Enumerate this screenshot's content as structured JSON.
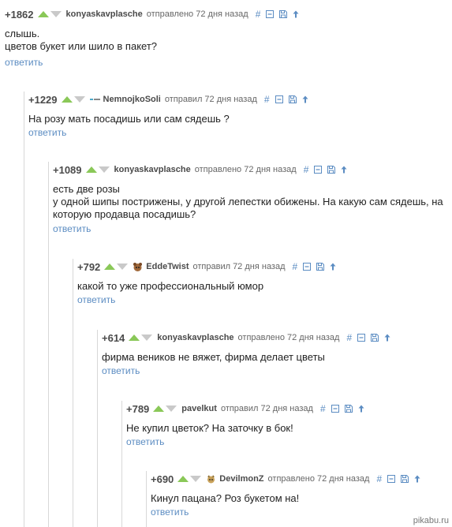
{
  "comments": [
    {
      "rating": "+1862",
      "user": "konyaskavplasche",
      "sent": "отправлено 72 дня назад",
      "avatar": "none",
      "lines": [
        "слышь.",
        "цветов букет или шило в пакет?"
      ],
      "reply": "ответить"
    },
    {
      "rating": "+1229",
      "user": "NemnojkoSoli",
      "sent": "отправил 72 дня назад",
      "avatar": "dash-avatar-icon",
      "lines": [
        "На розу мать посадишь или сам сядешь ?"
      ],
      "reply": "ответить"
    },
    {
      "rating": "+1089",
      "user": "konyaskavplasche",
      "sent": "отправлено 72 дня назад",
      "avatar": "none",
      "lines": [
        "есть две розы",
        "у одной шипы пострижены, у другой лепестки обижены. На какую сам сядешь, на",
        "которую продавца посадишь?"
      ],
      "reply": "ответить"
    },
    {
      "rating": "+792",
      "user": "EddeTwist",
      "sent": "отправил 72 дня назад",
      "avatar": "animal-avatar-icon",
      "lines": [
        "какой то уже профессиональный юмор"
      ],
      "reply": "ответить"
    },
    {
      "rating": "+614",
      "user": "konyaskavplasche",
      "sent": "отправлено 72 дня назад",
      "avatar": "none",
      "lines": [
        "фирма веников не вяжет, фирма делает цветы"
      ],
      "reply": "ответить"
    },
    {
      "rating": "+789",
      "user": "pavelkut",
      "sent": "отправил 72 дня назад",
      "avatar": "none",
      "lines": [
        "Не купил цветок? На заточку в бок!"
      ],
      "reply": "ответить"
    },
    {
      "rating": "+690",
      "user": "DevilmonZ",
      "sent": "отправлено 72 дня назад",
      "avatar": "creature-avatar-icon",
      "lines": [
        "Кинул пацана? Роз букетом на!"
      ],
      "reply": "ответить"
    }
  ],
  "actions": {
    "link": "#",
    "hide": "collapse-icon",
    "save": "save-icon",
    "parent": "up-arrow-icon"
  },
  "watermark": "pikabu.ru",
  "colors": {
    "link": "#5b8cc2",
    "upvote": "#8ac858",
    "downvote": "#c9c9c9",
    "thread_line": "#d8d8d8"
  }
}
